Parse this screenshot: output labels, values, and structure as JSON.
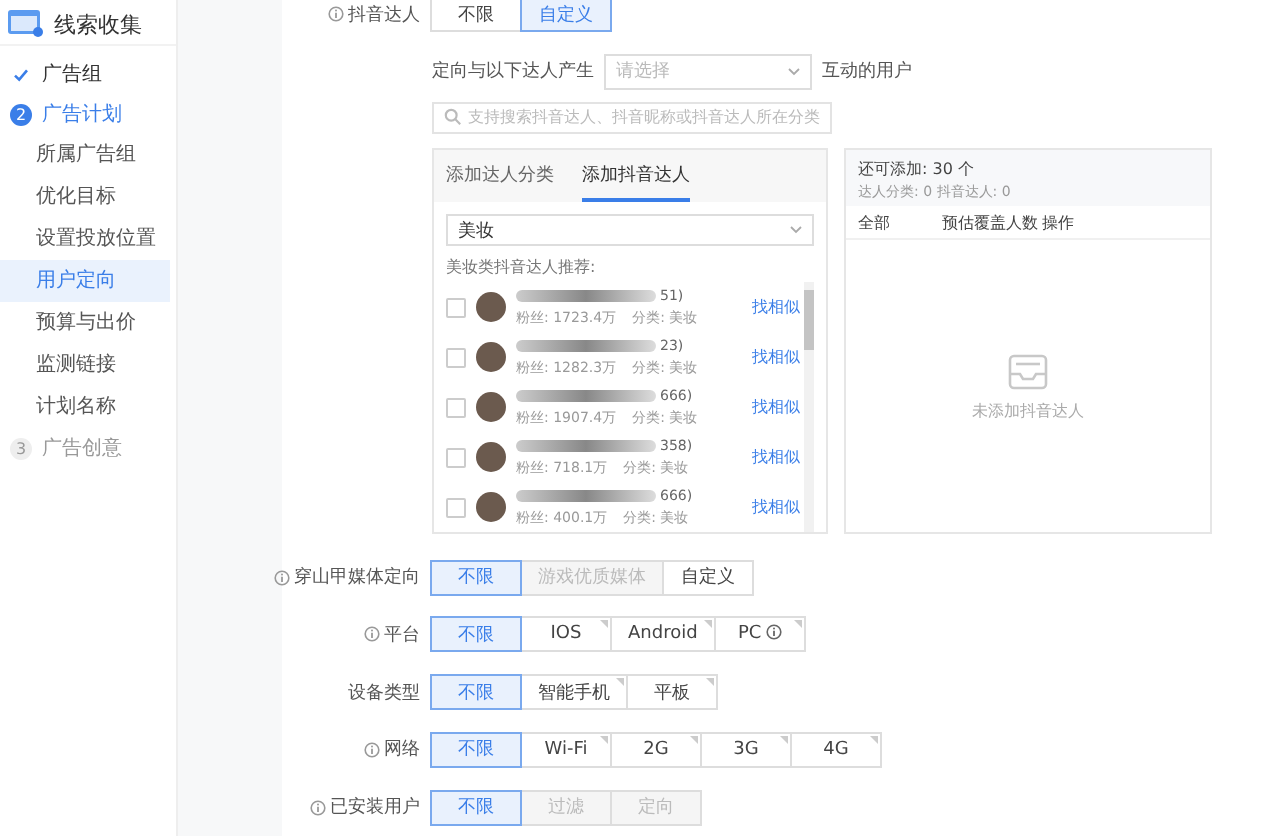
{
  "sidebar": {
    "title": "线索收集",
    "steps": [
      {
        "label": "广告组",
        "done": true,
        "active": false
      },
      {
        "number": "2",
        "label": "广告计划",
        "done": false,
        "active": true,
        "children": [
          {
            "label": "所属广告组",
            "selected": false
          },
          {
            "label": "优化目标",
            "selected": false
          },
          {
            "label": "设置投放位置",
            "selected": false
          },
          {
            "label": "用户定向",
            "selected": true
          },
          {
            "label": "预算与出价",
            "selected": false
          },
          {
            "label": "监测链接",
            "selected": false
          },
          {
            "label": "计划名称",
            "selected": false
          }
        ]
      },
      {
        "number": "3",
        "label": "广告创意",
        "done": false,
        "active": false
      }
    ]
  },
  "douyin_row": {
    "label": "抖音达人",
    "help": true,
    "options": [
      {
        "label": "不限",
        "selected": false,
        "disabled": false
      },
      {
        "label": "自定义",
        "selected": true,
        "disabled": false
      }
    ]
  },
  "interaction": {
    "prefix": "定向与以下达人产生",
    "select_placeholder": "请选择",
    "suffix": "互动的用户"
  },
  "search": {
    "placeholder": "支持搜索抖音达人、抖音昵称或抖音达人所在分类"
  },
  "picker": {
    "tabs": [
      {
        "label": "添加达人分类",
        "selected": false
      },
      {
        "label": "添加抖音达人",
        "selected": true
      }
    ],
    "category": "美妆",
    "recommend_title": "美妆类抖音达人推荐:",
    "creators": [
      {
        "checked": false,
        "name_tail": "51)",
        "fans": "粉丝: 1723.4万",
        "category": "分类: 美妆",
        "link": "找相似"
      },
      {
        "checked": false,
        "name_tail": "23)",
        "fans": "粉丝: 1282.3万",
        "category": "分类: 美妆",
        "link": "找相似"
      },
      {
        "checked": false,
        "name_tail": "666)",
        "fans": "粉丝: 1907.4万",
        "category": "分类: 美妆",
        "link": "找相似"
      },
      {
        "checked": false,
        "name_tail": "358)",
        "fans": "粉丝: 718.1万",
        "category": "分类: 美妆",
        "link": "找相似"
      },
      {
        "checked": false,
        "name_tail": "666)",
        "fans": "粉丝: 400.1万",
        "category": "分类: 美妆",
        "link": "找相似"
      }
    ]
  },
  "selected_panel": {
    "remaining": "还可添加: 30 个",
    "summary": "达人分类: 0 抖音达人: 0",
    "columns": [
      "全部",
      "预估覆盖人数",
      "操作"
    ],
    "empty_text": "未添加抖音达人"
  },
  "settings": [
    {
      "label": "穿山甲媒体定向",
      "help": true,
      "options": [
        {
          "label": "不限",
          "selected": true,
          "disabled": false
        },
        {
          "label": "游戏优质媒体",
          "selected": false,
          "disabled": true
        },
        {
          "label": "自定义",
          "selected": false,
          "disabled": false
        }
      ]
    },
    {
      "label": "平台",
      "help": true,
      "options": [
        {
          "label": "不限",
          "selected": true,
          "disabled": false
        },
        {
          "label": "IOS",
          "selected": false,
          "disabled": false,
          "marked": true
        },
        {
          "label": "Android",
          "selected": false,
          "disabled": false,
          "marked": true
        },
        {
          "label": "PC",
          "selected": false,
          "disabled": false,
          "marked": true,
          "help": true
        }
      ]
    },
    {
      "label": "设备类型",
      "help": false,
      "options": [
        {
          "label": "不限",
          "selected": true,
          "disabled": false
        },
        {
          "label": "智能手机",
          "selected": false,
          "disabled": false,
          "marked": true
        },
        {
          "label": "平板",
          "selected": false,
          "disabled": false,
          "marked": true
        }
      ]
    },
    {
      "label": "网络",
      "help": true,
      "options": [
        {
          "label": "不限",
          "selected": true,
          "disabled": false
        },
        {
          "label": "Wi-Fi",
          "selected": false,
          "disabled": false,
          "marked": true
        },
        {
          "label": "2G",
          "selected": false,
          "disabled": false,
          "marked": true
        },
        {
          "label": "3G",
          "selected": false,
          "disabled": false,
          "marked": true
        },
        {
          "label": "4G",
          "selected": false,
          "disabled": false,
          "marked": true
        }
      ]
    },
    {
      "label": "已安装用户",
      "help": true,
      "options": [
        {
          "label": "不限",
          "selected": true,
          "disabled": false
        },
        {
          "label": "过滤",
          "selected": false,
          "disabled": true
        },
        {
          "label": "定向",
          "selected": false,
          "disabled": true
        }
      ]
    }
  ]
}
